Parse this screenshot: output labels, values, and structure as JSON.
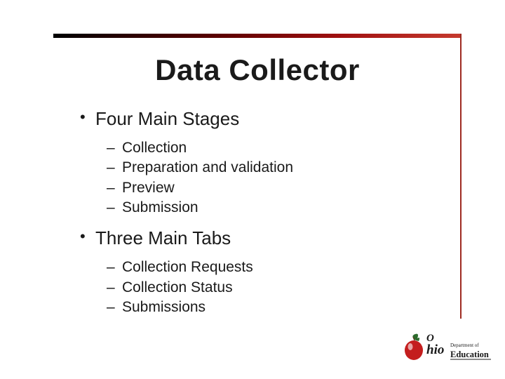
{
  "title": "Data Collector",
  "bullets": [
    {
      "label": "Four Main Stages",
      "sub": [
        "Collection",
        "Preparation and validation",
        "Preview",
        "Submission"
      ]
    },
    {
      "label": "Three Main Tabs",
      "sub": [
        "Collection Requests",
        "Collection Status",
        "Submissions"
      ]
    }
  ],
  "logo": {
    "dept": "Department of",
    "edu": "Education"
  }
}
